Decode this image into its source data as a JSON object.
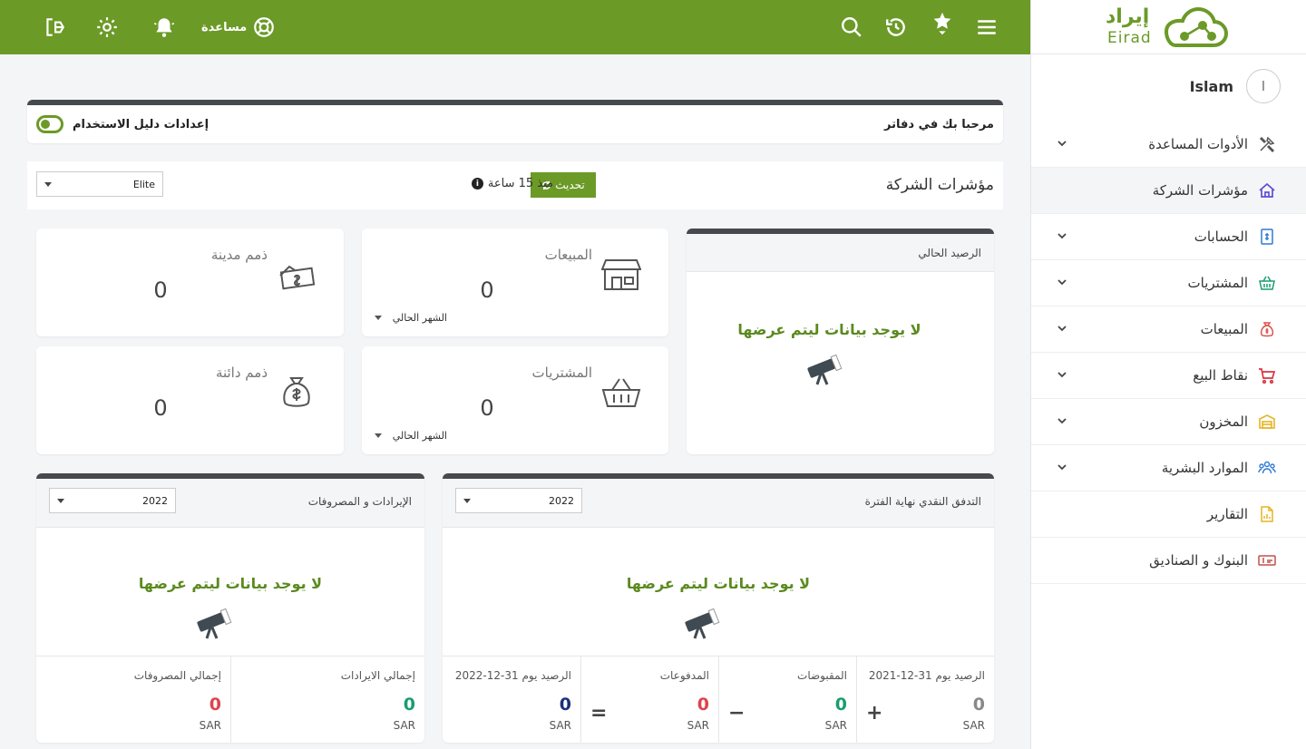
{
  "brand": {
    "name_ar": "إيراد",
    "name_en": "Eirad"
  },
  "topbar": {
    "help_label": "مساعدة"
  },
  "user": {
    "initial": "I",
    "name": "Islam"
  },
  "sidebar": {
    "items": [
      {
        "label": "الأدوات المساعدة",
        "icon": "tools-icon"
      },
      {
        "label": "مؤشرات الشركة",
        "icon": "home-icon"
      },
      {
        "label": "الحسابات",
        "icon": "accounts-icon"
      },
      {
        "label": "المشتريات",
        "icon": "basket-icon"
      },
      {
        "label": "المبيعات",
        "icon": "money-bag-icon"
      },
      {
        "label": "نقاط البيع",
        "icon": "cart-icon"
      },
      {
        "label": "المخزون",
        "icon": "warehouse-icon"
      },
      {
        "label": "الموارد البشرية",
        "icon": "users-icon"
      },
      {
        "label": "التقارير",
        "icon": "report-icon"
      },
      {
        "label": "البنوك و الصناديق",
        "icon": "bank-icon"
      }
    ]
  },
  "welcome": {
    "title": "مرحبا بك في دفاتر",
    "guide_label": "إعدادات دليل الاستخدام"
  },
  "kpi": {
    "title": "مؤشرات الشركة",
    "refresh_label": "تحديث",
    "since_label": "منذ 15 ساعة",
    "branch": "Elite"
  },
  "stats": {
    "sales": {
      "label": "المبيعات",
      "value": "0",
      "period": "الشهر الحالي"
    },
    "purchases": {
      "label": "المشتريات",
      "value": "0",
      "period": "الشهر الحالي"
    },
    "receivables": {
      "label": "ذمم مدينة",
      "value": "0"
    },
    "payables": {
      "label": "ذمم دائنة",
      "value": "0"
    }
  },
  "balance": {
    "title": "الرصيد الحالي",
    "empty": "لا يوجد بيانات ليتم عرضها"
  },
  "cashflow": {
    "title": "التدفق النقدي نهاية الفترة",
    "year": "2022",
    "empty": "لا يوجد بيانات ليتم عرضها",
    "opening_label": "الرصيد يوم 31-12-2021",
    "opening_value": "0",
    "receipts_label": "المقبوضات",
    "receipts_value": "0",
    "payments_label": "المدفوعات",
    "payments_value": "0",
    "closing_label": "الرصيد يوم 31-12-2022",
    "closing_value": "0",
    "currency": "SAR",
    "op_plus": "+",
    "op_minus": "−",
    "op_equals": "="
  },
  "income": {
    "title": "الإيرادات و المصروفات",
    "year": "2022",
    "empty": "لا يوجد بيانات ليتم عرضها",
    "revenue_label": "إجمالي الايرادات",
    "revenue_value": "0",
    "expense_label": "إجمالي المصروفات",
    "expense_value": "0",
    "currency": "SAR"
  },
  "colors": {
    "brand": "#6b9a27",
    "positive": "#1a9e6e",
    "negative": "#e0434d",
    "neutral": "#888888",
    "closing": "#1d2f7a"
  }
}
